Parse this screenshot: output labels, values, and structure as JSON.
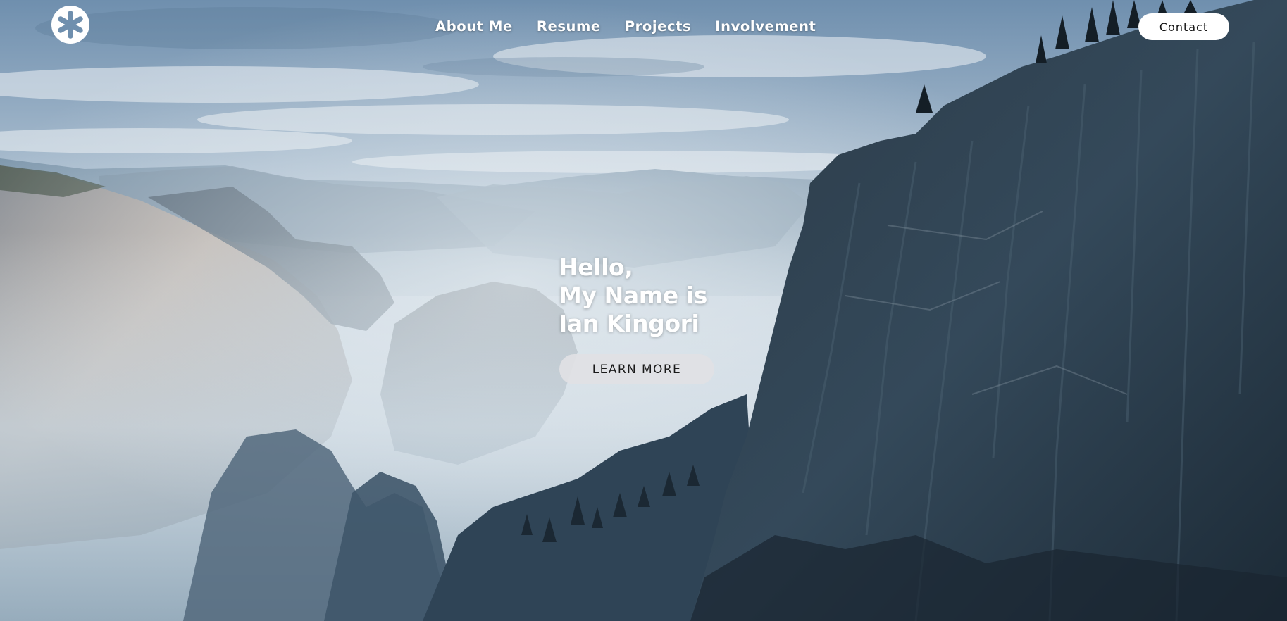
{
  "page": {
    "nav": {
      "links": [
        "About Me",
        "Resume",
        "Projects",
        "Involvement"
      ],
      "contact_label": "Contact"
    },
    "hero": {
      "lines": [
        "Hello,",
        "My Name is",
        "Ian Kingori"
      ],
      "button_label": "LEARN MORE"
    },
    "icons": {
      "logo": "asterisk-logo-icon"
    },
    "colors": {
      "sky": "#b7c9d8",
      "cliff_dark": "#253644",
      "button_light": "#e1e1e4",
      "text_white": "#ffffff"
    }
  }
}
